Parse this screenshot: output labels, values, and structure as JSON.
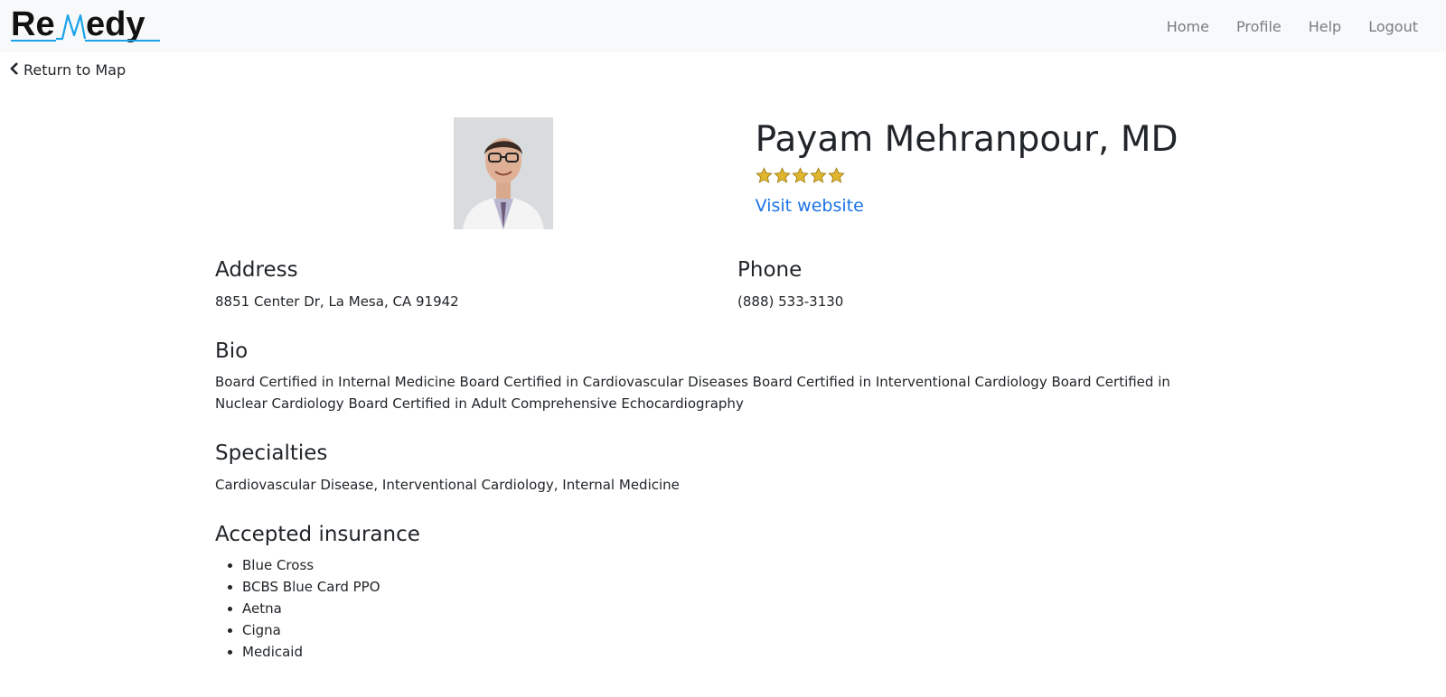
{
  "app": {
    "logo_text": "ReMedy"
  },
  "nav": {
    "links": [
      {
        "label": "Home"
      },
      {
        "label": "Profile"
      },
      {
        "label": "Help"
      },
      {
        "label": "Logout"
      }
    ]
  },
  "back": {
    "label": "Return to Map",
    "icon": "chevron-left-icon"
  },
  "doctor": {
    "name": "Payam Mehranpour, MD",
    "rating": 5,
    "rating_max": 5,
    "website_label": "Visit website"
  },
  "address": {
    "heading": "Address",
    "value": "8851 Center Dr, La Mesa, CA 91942"
  },
  "phone": {
    "heading": "Phone",
    "value": "(888) 533-3130"
  },
  "bio": {
    "heading": "Bio",
    "text": "Board Certified in Internal Medicine Board Certified in Cardiovascular Diseases Board Certified in Interventional Cardiology Board Certified in Nuclear Cardiology Board Certified in Adult Comprehensive Echocardiography"
  },
  "specialties": {
    "heading": "Specialties",
    "text": "Cardiovascular Disease, Interventional Cardiology, Internal Medicine"
  },
  "insurance": {
    "heading": "Accepted insurance",
    "items": [
      "Blue Cross",
      "BCBS Blue Card PPO",
      "Aetna",
      "Cigna",
      "Medicaid"
    ]
  },
  "colors": {
    "navbar_bg": "#f8f9fa",
    "link_blue": "#1a73e8",
    "star_gold": "#e0b52e",
    "logo_accent": "#1aa3e8"
  }
}
